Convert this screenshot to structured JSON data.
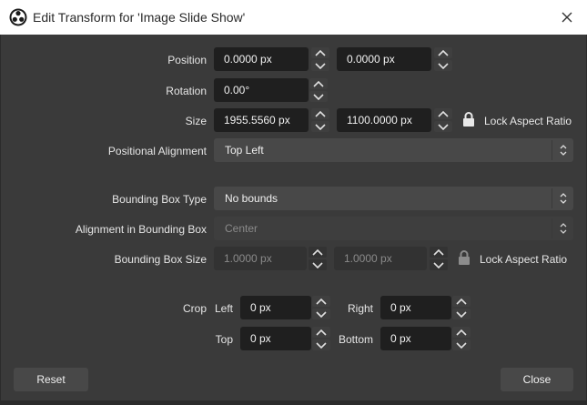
{
  "window": {
    "title": "Edit Transform for 'Image Slide Show'"
  },
  "position": {
    "label": "Position",
    "x": "0.0000 px",
    "y": "0.0000 px"
  },
  "rotation": {
    "label": "Rotation",
    "value": "0.00°"
  },
  "size": {
    "label": "Size",
    "width": "1955.5560 px",
    "height": "1100.0000 px",
    "lock_label": "Lock Aspect Ratio"
  },
  "positional_alignment": {
    "label": "Positional Alignment",
    "value": "Top Left"
  },
  "bounding_box_type": {
    "label": "Bounding Box Type",
    "value": "No bounds"
  },
  "alignment_in_bounding_box": {
    "label": "Alignment in Bounding Box",
    "value": "Center"
  },
  "bounding_box_size": {
    "label": "Bounding Box Size",
    "width": "1.0000 px",
    "height": "1.0000 px",
    "lock_label": "Lock Aspect Ratio"
  },
  "crop": {
    "label": "Crop",
    "left_label": "Left",
    "left": "0 px",
    "right_label": "Right",
    "right": "0 px",
    "top_label": "Top",
    "top": "0 px",
    "bottom_label": "Bottom",
    "bottom": "0 px"
  },
  "buttons": {
    "reset": "Reset",
    "close": "Close"
  },
  "icons": {
    "app": "obs-logo-icon",
    "close": "close-icon",
    "lock": "lock-icon",
    "spin_up": "chevron-up-icon",
    "spin_down": "chevron-down-icon",
    "combo": "updown-arrows-icon"
  }
}
